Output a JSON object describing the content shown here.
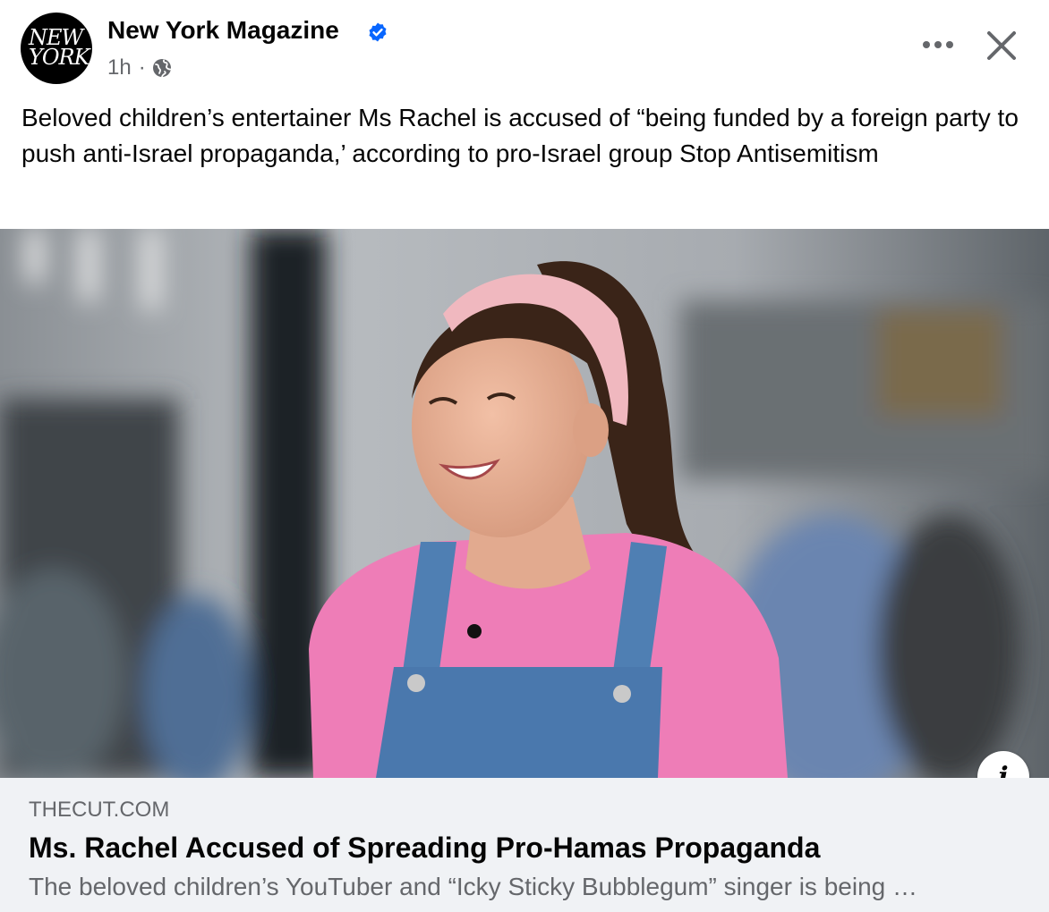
{
  "post": {
    "page_name": "New York Magazine",
    "avatar_line1": "NEW",
    "avatar_line2": "YORK",
    "time": "1h",
    "separator": "·",
    "verified_icon": "verified-badge-icon",
    "privacy_icon": "globe-icon",
    "more_label": "•••",
    "caption": "Beloved children’s entertainer Ms Rachel is accused of “being funded by a foreign party to push anti-Israel propaganda,’ according to pro-Israel group Stop Antisemitism"
  },
  "link_preview": {
    "domain": "THECUT.COM",
    "title": "Ms. Rachel Accused of Spreading Pro-Hamas Propaganda",
    "description": "The beloved children’s YouTuber and “Icky Sticky Bubblegum” singer is being …",
    "info_label": "i"
  },
  "colors": {
    "verified_blue": "#0866ff",
    "secondary_text": "#65676b",
    "link_background": "#f0f2f5"
  }
}
